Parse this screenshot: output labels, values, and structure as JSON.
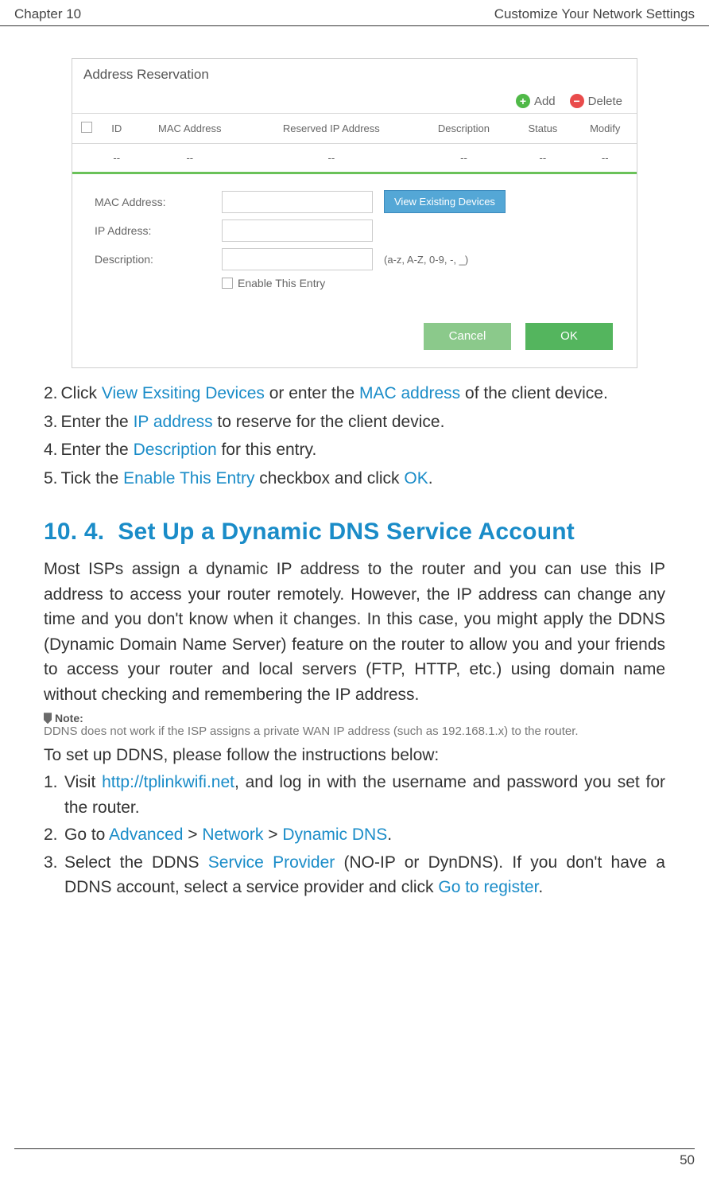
{
  "header": {
    "left": "Chapter 10",
    "right": "Customize Your Network Settings"
  },
  "ui": {
    "panel_title": "Address Reservation",
    "toolbar": {
      "add": "Add",
      "delete": "Delete"
    },
    "table": {
      "headers": [
        "",
        "ID",
        "MAC Address",
        "Reserved IP Address",
        "Description",
        "Status",
        "Modify"
      ],
      "row": [
        "",
        "--",
        "--",
        "--",
        "--",
        "--",
        "--"
      ]
    },
    "form": {
      "mac_label": "MAC Address:",
      "ip_label": "IP Address:",
      "desc_label": "Description:",
      "view_btn": "View Existing Devices",
      "desc_hint": "(a-z, A-Z, 0-9, -, _)",
      "enable_label": "Enable This Entry",
      "cancel": "Cancel",
      "ok": "OK"
    }
  },
  "steps_a": [
    {
      "n": "2.",
      "pre": "Click ",
      "b1": "View Exsiting Devices",
      "mid": " or enter the ",
      "b2": "MAC address",
      "post": " of the client device."
    },
    {
      "n": "3.",
      "pre": "Enter the ",
      "b1": "IP address",
      "mid": "",
      "b2": "",
      "post": " to reserve for the client device."
    },
    {
      "n": "4.",
      "pre": "Enter the ",
      "b1": "Description",
      "mid": "",
      "b2": "",
      "post": " for this entry."
    },
    {
      "n": "5.",
      "pre": "Tick the ",
      "b1": "Enable This Entry",
      "mid": " checkbox and click ",
      "b2": "OK",
      "post": "."
    }
  ],
  "section": {
    "num": "10. 4.",
    "title": "Set Up a Dynamic DNS Service Account"
  },
  "para1": "Most ISPs assign a dynamic IP address to the router and you can use this IP address to access your router remotely. However, the IP address can change any time and you don't know when it changes. In this case, you might apply the DDNS (Dynamic Domain Name Server) feature on the router to allow you and your friends to access your router and local servers (FTP, HTTP, etc.) using domain name without checking and remembering the IP address.",
  "note": {
    "label": "Note:",
    "text": "DDNS does not work if the ISP assigns a private WAN IP address (such as 192.168.1.x) to the router."
  },
  "followup": "To set up DDNS, please follow the instructions below:",
  "steps_b": {
    "s1_pre": "Visit ",
    "s1_link": "http://tplinkwifi.net",
    "s1_post": ", and log in with the username and password you set for the router.",
    "s2_pre": "Go to ",
    "s2_a": "Advanced",
    "s2_gt1": " > ",
    "s2_b": "Network",
    "s2_gt2": " > ",
    "s2_c": "Dynamic DNS",
    "s2_post": ".",
    "s3_pre": "Select the DDNS ",
    "s3_sp": "Service Provider",
    "s3_mid": " (NO-IP or DynDNS). If you don't have a DDNS account, select a service provider and click ",
    "s3_reg": "Go to register",
    "s3_post": "."
  },
  "page_number": "50"
}
